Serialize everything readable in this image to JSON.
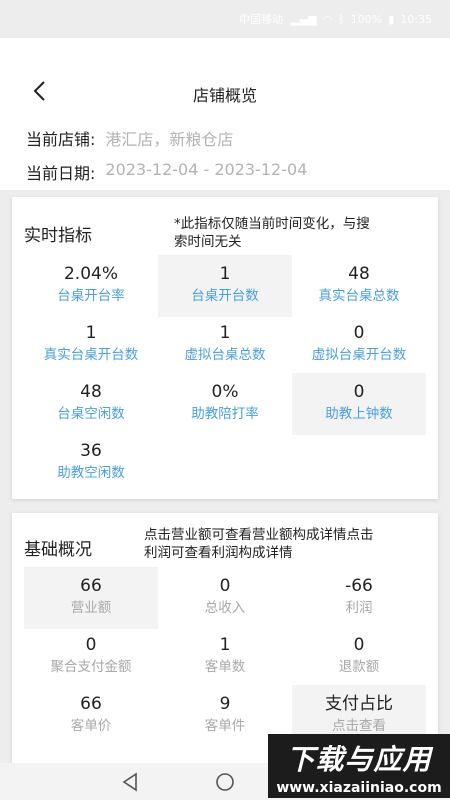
{
  "status_bar": {
    "carrier": "中国移动",
    "battery": "100%",
    "time": "10:35"
  },
  "header": {
    "title": "店铺概览"
  },
  "info": {
    "shop_label": "当前店铺:",
    "shop_value": "港汇店，新粮仓店",
    "date_label": "当前日期:",
    "date_value": "2023-12-04 - 2023-12-04"
  },
  "realtime": {
    "title": "实时指标",
    "note_line1": "*此指标仅随当前时间变化，与搜",
    "note_line2": "索时间无关",
    "cells": [
      {
        "value": "2.04%",
        "label": "台桌开台率"
      },
      {
        "value": "1",
        "label": "台桌开台数"
      },
      {
        "value": "48",
        "label": "真实台桌总数"
      },
      {
        "value": "1",
        "label": "真实台桌开台数"
      },
      {
        "value": "1",
        "label": "虚拟台桌总数"
      },
      {
        "value": "0",
        "label": "虚拟台桌开台数"
      },
      {
        "value": "48",
        "label": "台桌空闲数"
      },
      {
        "value": "0%",
        "label": "助教陪打率"
      },
      {
        "value": "0",
        "label": "助教上钟数"
      },
      {
        "value": "36",
        "label": "助教空闲数"
      }
    ]
  },
  "basic": {
    "title": "基础概况",
    "note_line1": "点击营业额可查看营业额构成详情点击",
    "note_line2": "利润可查看利润构成详情",
    "cells": [
      {
        "value": "66",
        "label": "营业额"
      },
      {
        "value": "0",
        "label": "总收入"
      },
      {
        "value": "-66",
        "label": "利润"
      },
      {
        "value": "0",
        "label": "聚合支付金额"
      },
      {
        "value": "1",
        "label": "客单数"
      },
      {
        "value": "0",
        "label": "退款额"
      },
      {
        "value": "66",
        "label": "客单价"
      },
      {
        "value": "9",
        "label": "客单件"
      },
      {
        "value": "支付占比",
        "label": "点击查看"
      }
    ]
  },
  "watermark": {
    "line1": "下载与应用",
    "line2": "www.xiazaiiniao.com"
  }
}
